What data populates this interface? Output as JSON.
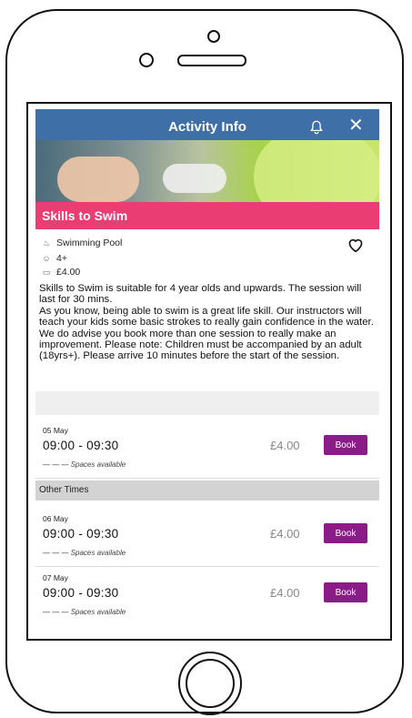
{
  "header": {
    "title": "Activity Info"
  },
  "activity": {
    "title": "Skills to Swim",
    "location": "Swimming Pool",
    "age": "4+",
    "price": "£4.00",
    "description": "Skills to Swim is suitable for 4 year olds and upwards. The session will last for 30 mins.\nAs you know, being able to swim is a great life skill. Our instructors will teach your kids some basic strokes to really gain confidence in the water. We do advise you book more than one session to really make an improvement. Please note: Children must be accompanied by an adult (18yrs+). Please arrive 10 minutes before the start of the session."
  },
  "icons": {
    "location": "pool-icon",
    "age": "person-icon",
    "price": "ticket-icon",
    "favorite": "heart-icon",
    "notify": "bell-icon",
    "close": "close-icon"
  },
  "colors": {
    "header": "#3f6fa7",
    "banner": "#ea3d73",
    "book_button": "#8a1b87"
  },
  "other_times_label": "Other Times",
  "sessions": [
    {
      "date": "05 May",
      "time": "09:00 - 09:30",
      "price": "£4.00",
      "book_label": "Book",
      "spaces_dashes": "— — —",
      "spaces_label": "Spaces available"
    },
    {
      "date": "06 May",
      "time": "09:00 - 09:30",
      "price": "£4.00",
      "book_label": "Book",
      "spaces_dashes": "— — —",
      "spaces_label": "Spaces available"
    },
    {
      "date": "07 May",
      "time": "09:00 - 09:30",
      "price": "£4.00",
      "book_label": "Book",
      "spaces_dashes": "— — —",
      "spaces_label": "Spaces available"
    }
  ]
}
